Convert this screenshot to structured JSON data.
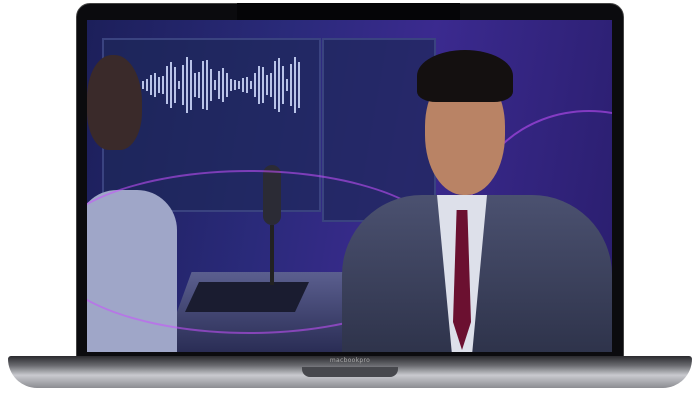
{
  "device": {
    "label": "macbookpro"
  },
  "colors": {
    "screen_bg": "#2a2a7a",
    "accent": "#c850ff"
  }
}
